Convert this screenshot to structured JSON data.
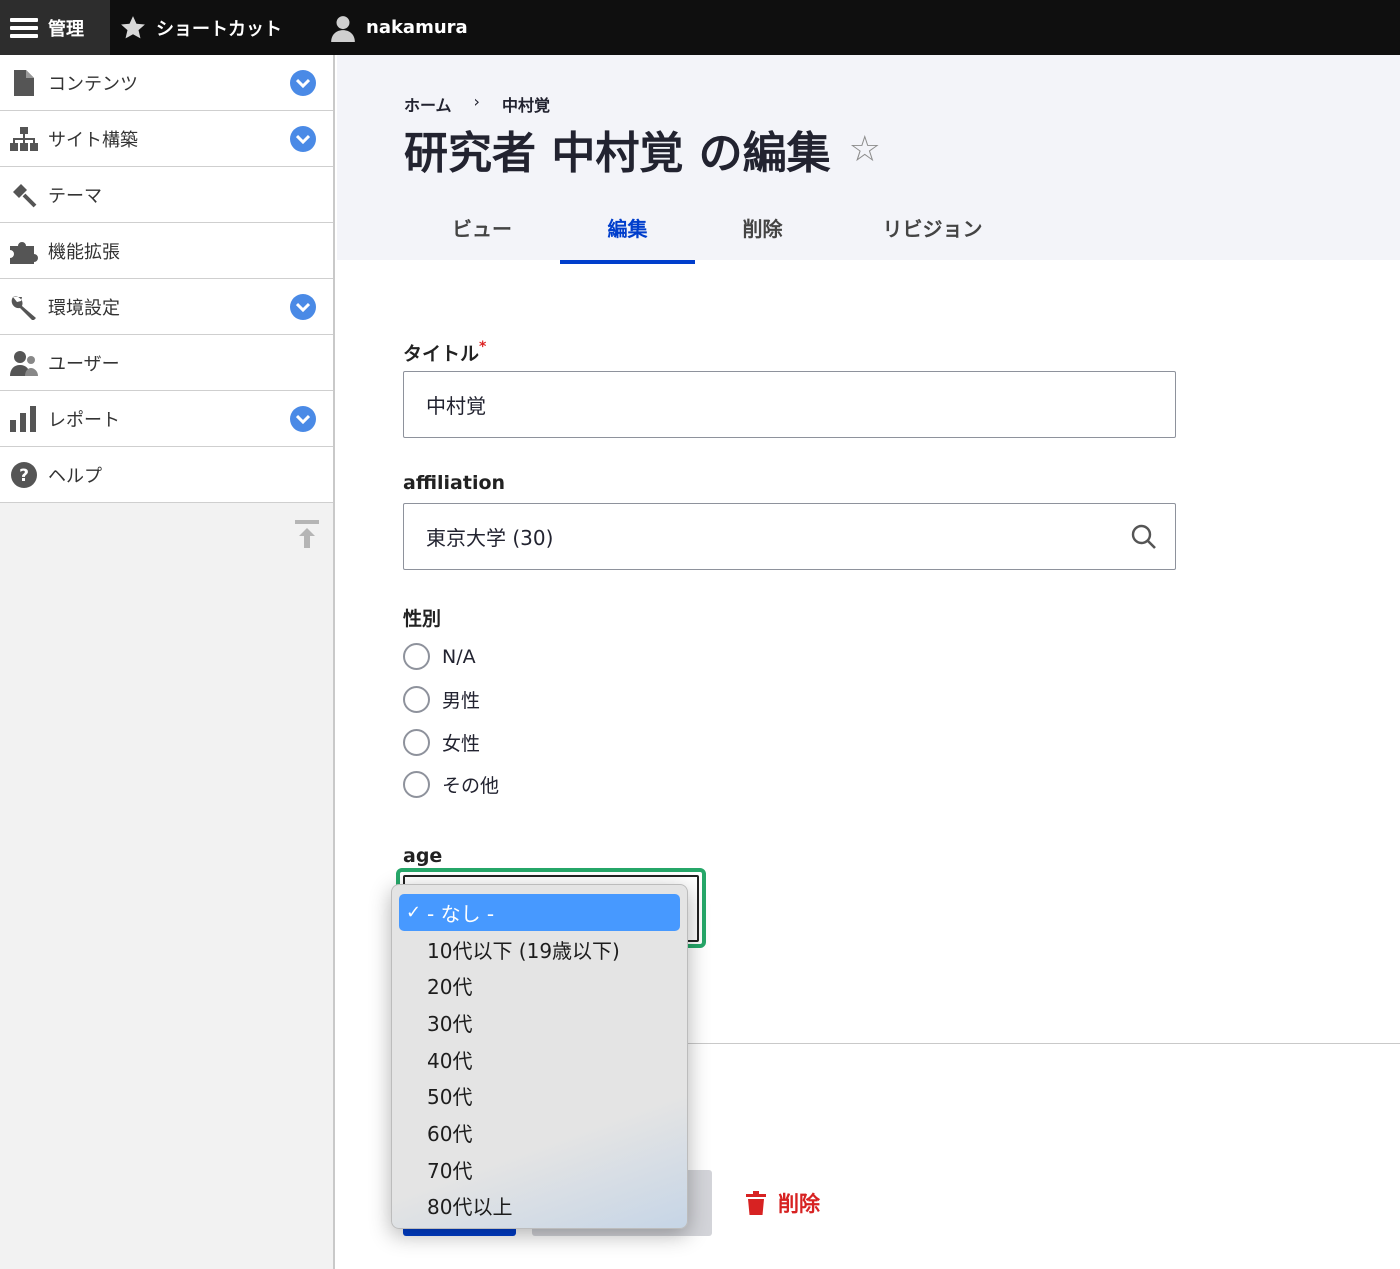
{
  "toolbar": {
    "manage": "管理",
    "shortcuts": "ショートカット",
    "user": "nakamura"
  },
  "sidebar": {
    "items": [
      {
        "label": "コンテンツ",
        "icon": "file-icon",
        "expandable": true
      },
      {
        "label": "サイト構築",
        "icon": "sitemap-icon",
        "expandable": true
      },
      {
        "label": "テーマ",
        "icon": "paint-roller-icon",
        "expandable": false
      },
      {
        "label": "機能拡張",
        "icon": "puzzle-icon",
        "expandable": false
      },
      {
        "label": "環境設定",
        "icon": "wrench-icon",
        "expandable": true
      },
      {
        "label": "ユーザー",
        "icon": "people-icon",
        "expandable": false
      },
      {
        "label": "レポート",
        "icon": "bar-chart-icon",
        "expandable": true
      },
      {
        "label": "ヘルプ",
        "icon": "help-icon",
        "expandable": false
      }
    ]
  },
  "breadcrumb": {
    "home": "ホーム",
    "sep": "›",
    "current": "中村覚"
  },
  "page": {
    "title": "研究者 中村覚 の編集",
    "star": "☆"
  },
  "tabs": [
    "ビュー",
    "編集",
    "削除",
    "リビジョン"
  ],
  "form": {
    "title_label": "タイトル",
    "title_required": "*",
    "title_value": "中村覚",
    "affiliation_label": "affiliation",
    "affiliation_value": "東京大学 (30)",
    "gender_label": "性別",
    "gender_options": [
      "N/A",
      "男性",
      "女性",
      "その他"
    ],
    "age_label": "age",
    "age_options": [
      "- なし -",
      "10代以下 (19歳以下)",
      "20代",
      "30代",
      "40代",
      "50代",
      "60代",
      "70代",
      "80代以上"
    ],
    "age_selected_check": "✓",
    "delete_label": "削除"
  },
  "colors": {
    "accent": "#003ecc",
    "focus": "#26a769",
    "danger": "#d72222",
    "chevron": "#4a8ae6"
  }
}
